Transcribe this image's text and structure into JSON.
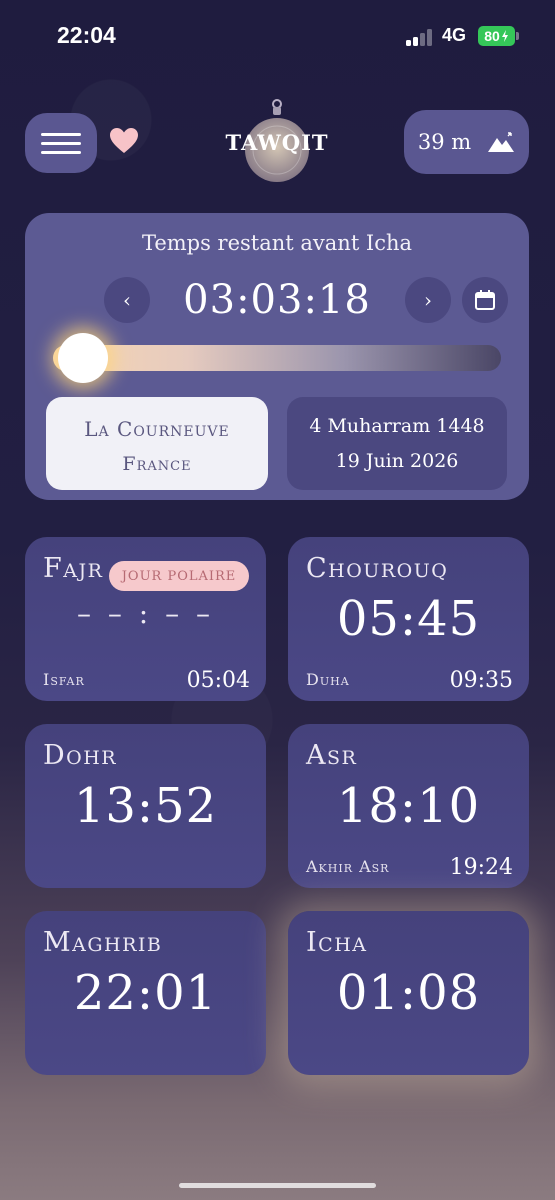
{
  "status_bar": {
    "time": "22:04",
    "network": "4G",
    "battery": "80"
  },
  "header": {
    "logo_text": "TAWQIT",
    "altitude": "39 m",
    "icons": [
      "menu-icon",
      "heart-icon",
      "mountain-icon"
    ]
  },
  "countdown": {
    "title": "Temps restant avant Icha",
    "time": "03:03:18",
    "progress_fraction": 0.02,
    "prev_label": "‹",
    "next_label": "›"
  },
  "location": {
    "city": "La Courneuve",
    "country": "France"
  },
  "date": {
    "hijri": "4 Muharram 1448",
    "gregorian": "19 Juin 2026"
  },
  "prayers": {
    "fajr": {
      "name": "Fajr",
      "badge": "JOUR POLAIRE",
      "time": "– – : – –",
      "sub_label": "Isfar",
      "sub_time": "05:04"
    },
    "chourouq": {
      "name": "Chourouq",
      "time": "05:45",
      "sub_label": "Duha",
      "sub_time": "09:35"
    },
    "dohr": {
      "name": "Dohr",
      "time": "13:52"
    },
    "asr": {
      "name": "Asr",
      "time": "18:10",
      "sub_label": "Akhir Asr",
      "sub_time": "19:24"
    },
    "maghrib": {
      "name": "Maghrib",
      "time": "22:01"
    },
    "icha": {
      "name": "Icha",
      "time": "01:08"
    }
  },
  "colors": {
    "card": "#5c5a93",
    "prayer_card": "#45427c",
    "badge_bg": "#f6c9cc",
    "battery": "#35c759"
  }
}
